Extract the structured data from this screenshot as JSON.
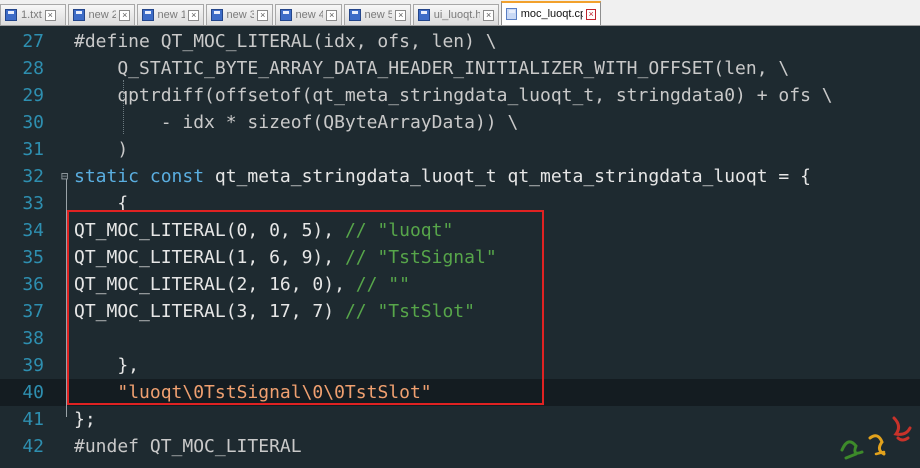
{
  "tabs": [
    {
      "label": "1.txt",
      "active": false
    },
    {
      "label": "new 2",
      "active": false
    },
    {
      "label": "new 1",
      "active": false
    },
    {
      "label": "new 3",
      "active": false
    },
    {
      "label": "new 4",
      "active": false
    },
    {
      "label": "new 5",
      "active": false
    },
    {
      "label": "ui_luoqt.h",
      "active": false
    },
    {
      "label": "moc_luoqt.cpp",
      "active": true
    }
  ],
  "close_glyph": "×",
  "lines": [
    {
      "n": "27",
      "segments": [
        {
          "t": "#define QT_MOC_LITERAL(idx, ofs, len) \\",
          "c": "pre"
        }
      ]
    },
    {
      "n": "28",
      "segments": [
        {
          "t": "    Q_STATIC_BYTE_ARRAY_DATA_HEADER_INITIALIZER_WITH_OFFSET(len, \\",
          "c": "pre"
        }
      ]
    },
    {
      "n": "29",
      "segments": [
        {
          "t": "    qptrdiff(offsetof(qt_meta_stringdata_luoqt_t, stringdata0) + ofs \\",
          "c": "pre"
        }
      ]
    },
    {
      "n": "30",
      "segments": [
        {
          "t": "        - idx * sizeof(QByteArrayData)) \\",
          "c": "pre"
        }
      ]
    },
    {
      "n": "31",
      "segments": [
        {
          "t": "    )",
          "c": "pre"
        }
      ]
    },
    {
      "n": "32",
      "segments": [
        {
          "t": "static const",
          "c": "kw"
        },
        {
          "t": " qt_meta_stringdata_luoqt_t qt_meta_stringdata_luoqt = {",
          "c": "plain"
        }
      ]
    },
    {
      "n": "33",
      "segments": [
        {
          "t": "    {",
          "c": "plain"
        }
      ]
    },
    {
      "n": "34",
      "segments": [
        {
          "t": "QT_MOC_LITERAL(0, 0, 5), ",
          "c": "plain"
        },
        {
          "t": "// \"luoqt\"",
          "c": "cmt"
        }
      ]
    },
    {
      "n": "35",
      "segments": [
        {
          "t": "QT_MOC_LITERAL(1, 6, 9), ",
          "c": "plain"
        },
        {
          "t": "// \"TstSignal\"",
          "c": "cmt"
        }
      ]
    },
    {
      "n": "36",
      "segments": [
        {
          "t": "QT_MOC_LITERAL(2, 16, 0), ",
          "c": "plain"
        },
        {
          "t": "// \"\"",
          "c": "cmt"
        }
      ]
    },
    {
      "n": "37",
      "segments": [
        {
          "t": "QT_MOC_LITERAL(3, 17, 7) ",
          "c": "plain"
        },
        {
          "t": "// \"TstSlot\"",
          "c": "cmt"
        }
      ]
    },
    {
      "n": "38",
      "segments": []
    },
    {
      "n": "39",
      "segments": [
        {
          "t": "    },",
          "c": "plain"
        }
      ]
    },
    {
      "n": "40",
      "segments": [
        {
          "t": "    ",
          "c": "plain"
        },
        {
          "t": "\"luoqt\\0TstSignal\\0\\0TstSlot\"",
          "c": "str"
        }
      ]
    },
    {
      "n": "41",
      "segments": [
        {
          "t": "};",
          "c": "plain"
        }
      ]
    },
    {
      "n": "42",
      "segments": [
        {
          "t": "#undef QT_MOC_LITERAL",
          "c": "pre"
        }
      ]
    }
  ],
  "current_line": "40",
  "fold_markers": {
    "32": "⊟"
  },
  "colors": {
    "highlight_border": "#e02222",
    "line_numbers": "#2e8fb0",
    "keyword": "#5aaee0",
    "comment": "#57a64a",
    "string": "#f0a070"
  }
}
